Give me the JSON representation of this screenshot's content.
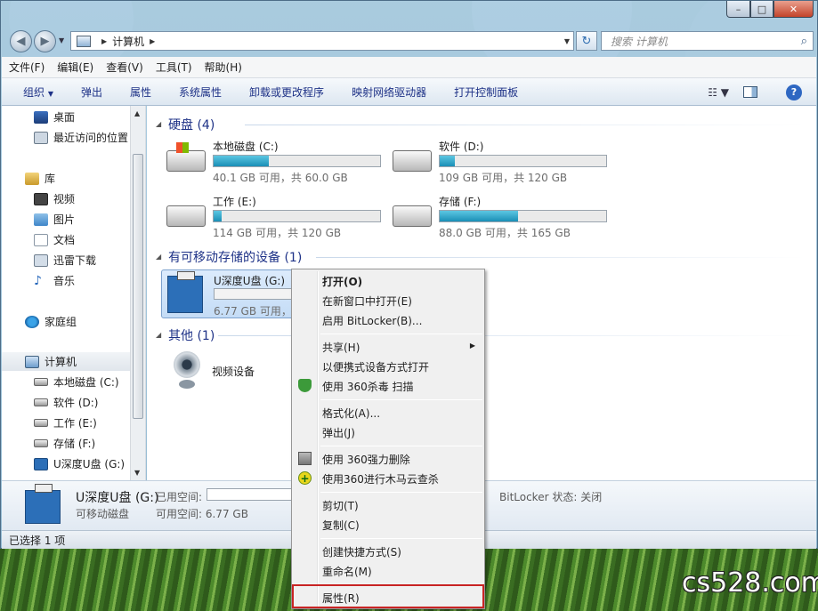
{
  "window": {
    "controls": {
      "minimize": "–",
      "maximize": "□",
      "close": "✕"
    }
  },
  "navigation": {
    "address_path": [
      "计算机"
    ],
    "search_placeholder": "搜索 计算机"
  },
  "menubar": [
    "文件(F)",
    "编辑(E)",
    "查看(V)",
    "工具(T)",
    "帮助(H)"
  ],
  "toolbar": {
    "organize": "组织",
    "eject": "弹出",
    "properties": "属性",
    "system_properties": "系统属性",
    "uninstall": "卸载或更改程序",
    "map_drive": "映射网络驱动器",
    "control_panel": "打开控制面板"
  },
  "sidebar": {
    "items": [
      {
        "label": "桌面"
      },
      {
        "label": "最近访问的位置"
      },
      {
        "label": "库"
      },
      {
        "label": "视频"
      },
      {
        "label": "图片"
      },
      {
        "label": "文档"
      },
      {
        "label": "迅雷下载"
      },
      {
        "label": "音乐"
      },
      {
        "label": "家庭组"
      },
      {
        "label": "计算机"
      },
      {
        "label": "本地磁盘 (C:)"
      },
      {
        "label": "软件 (D:)"
      },
      {
        "label": "工作 (E:)"
      },
      {
        "label": "存储 (F:)"
      },
      {
        "label": "U深度U盘 (G:)"
      }
    ]
  },
  "groups": {
    "hard_disks": "硬盘 (4)",
    "removable": "有可移动存储的设备 (1)",
    "other": "其他 (1)"
  },
  "drives": [
    {
      "name": "本地磁盘 (C:)",
      "info": "40.1 GB 可用，共 60.0 GB",
      "used_fraction": 0.33
    },
    {
      "name": "软件 (D:)",
      "info": "109 GB 可用，共 120 GB",
      "used_fraction": 0.09
    },
    {
      "name": "工作 (E:)",
      "info": "114 GB 可用，共 120 GB",
      "used_fraction": 0.05
    },
    {
      "name": "存储 (F:)",
      "info": "88.0 GB 可用，共 165 GB",
      "used_fraction": 0.47
    }
  ],
  "usb": {
    "name": "U深度U盘 (G:)",
    "info": "6.77 GB 可用，共"
  },
  "other_device": {
    "label": "视频设备"
  },
  "details": {
    "name": "U深度U盘 (G:)",
    "type": "可移动磁盘",
    "used_label": "已用空间:",
    "free": "可用空间: 6.77 GB",
    "bitlocker": "BitLocker 状态: 关闭"
  },
  "statusbar": {
    "text": "已选择 1 项"
  },
  "context_menu": {
    "items": [
      "打开(O)",
      "在新窗口中打开(E)",
      "启用 BitLocker(B)...",
      "共享(H)",
      "以便携式设备方式打开",
      "使用 360杀毒 扫描",
      "格式化(A)...",
      "弹出(J)",
      "使用 360强力删除",
      "使用360进行木马云查杀",
      "剪切(T)",
      "复制(C)",
      "创建快捷方式(S)",
      "重命名(M)",
      "属性(R)"
    ],
    "submenu_arrow": "▶"
  },
  "watermark": "cs528.com",
  "colors": {
    "accent_text": "#1e3287",
    "drive_fill": "#1a8fb6",
    "highlight_box": "#c82424"
  }
}
